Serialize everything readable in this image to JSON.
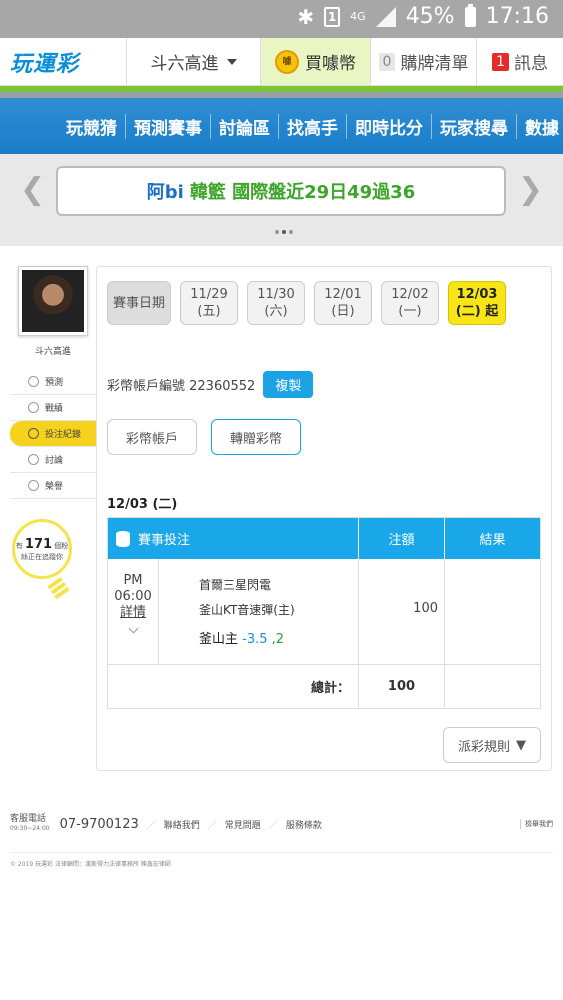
{
  "status": {
    "battery": "45%",
    "time": "17:16",
    "sim": "1",
    "net": "4G"
  },
  "topnav": {
    "logo": "玩運彩",
    "user": "斗六高進",
    "buy": "買噱幣",
    "coin_glyph": "噱",
    "list_count": "0",
    "list_label": "購牌清單",
    "msg_count": "1",
    "msg_label": "訊息"
  },
  "menu": [
    "玩競猜",
    "預測賽事",
    "討論區",
    "找高手",
    "即時比分",
    "玩家搜尋",
    "數據"
  ],
  "banner": {
    "name": "阿bi",
    "text": "韓籃 國際盤近29日49過36"
  },
  "sidebar": {
    "username": "斗六高進",
    "items": [
      "預測",
      "戰績",
      "投注紀錄",
      "討論",
      "榮譽"
    ],
    "bulb_prefix": "有",
    "bulb_count": "171",
    "bulb_unit": "個粉",
    "bulb_suffix": "絲正在追蹤你"
  },
  "dates": {
    "label": "賽事日期",
    "items": [
      {
        "d": "11/29",
        "w": "(五)"
      },
      {
        "d": "11/30",
        "w": "(六)"
      },
      {
        "d": "12/01",
        "w": "(日)"
      },
      {
        "d": "12/02",
        "w": "(一)"
      }
    ],
    "selected_d": "12/03",
    "selected_w": "(二) 起"
  },
  "account": {
    "label": "彩幣帳戶編號 22360552",
    "copy": "複製"
  },
  "buttons": {
    "wallet": "彩幣帳戶",
    "gift": "轉贈彩幣"
  },
  "day_title": "12/03 (二)",
  "table": {
    "headers": {
      "event": "賽事投注",
      "amount": "注額",
      "result": "結果"
    },
    "row": {
      "ampm": "PM",
      "time": "06:00",
      "detail": "詳情",
      "team1": "首爾三星閃電",
      "team2": "釜山KT音速彈(主)",
      "pick_team": "釜山主",
      "pick_line": "-3.5",
      "pick_odds": ",2",
      "amount": "100",
      "result": ""
    },
    "total_label": "總計：",
    "total": "100"
  },
  "rule_button": "派彩規則",
  "footer": {
    "service": "客服電話",
    "hours": "09:30~24:00",
    "phone": "07-9700123",
    "links": [
      "聯絡我們",
      "常見問題",
      "服務條款"
    ],
    "report": "檢舉我們",
    "copyright": "© 2019 玩運彩 法律顧問：漢斯得力法律事務所 陳鑫宏律師"
  }
}
